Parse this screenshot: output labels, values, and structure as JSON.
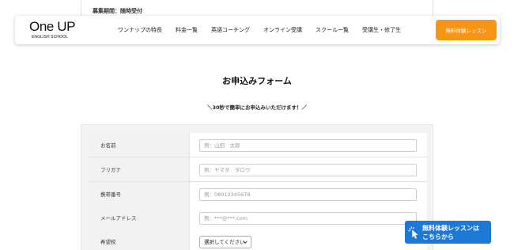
{
  "background_text": "募集期間：随時受付",
  "header": {
    "logo_main": "One UP",
    "logo_sub": "ENGLISH SCHOOL",
    "nav": [
      "ワンナップの特長",
      "料金一覧",
      "英語コーチング",
      "オンライン受講",
      "スクール一覧",
      "受講生・修了生"
    ],
    "cta_label": "無料体験レッスン"
  },
  "form": {
    "title": "お申込みフォーム",
    "subtitle": "＼30秒で簡単にお申込みいただけます！／",
    "fields": [
      {
        "label": "お名前",
        "placeholder": "例：山田　太郎"
      },
      {
        "label": "フリガナ",
        "placeholder": "例：ヤマダ　タロウ"
      },
      {
        "label": "携帯番号",
        "placeholder": "例：08012345678"
      },
      {
        "label": "メールアドレス",
        "placeholder": "例：***@***.com"
      }
    ],
    "school": {
      "label": "希望校",
      "selected": "選択してください"
    }
  },
  "float_badge": {
    "line1": "無料体験レッスンは",
    "line2": "こちらから"
  },
  "colors": {
    "accent_orange": "#f79514",
    "badge_blue": "#1e78d6"
  }
}
